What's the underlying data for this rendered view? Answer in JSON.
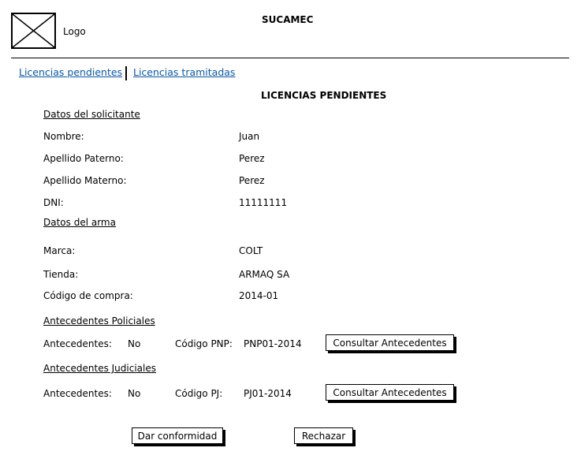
{
  "header": {
    "app_title": "SUCAMEC",
    "logo_label": "Logo"
  },
  "nav": {
    "pending_link": "Licencias pendientes",
    "processed_link": "Licencias tramitadas"
  },
  "page_title": "LICENCIAS PENDIENTES",
  "applicant": {
    "section_title": "Datos del solicitante",
    "fields": [
      {
        "label": "Nombre:",
        "value": "Juan"
      },
      {
        "label": "Apellido Paterno:",
        "value": "Perez"
      },
      {
        "label": "Apellido Materno:",
        "value": "Perez"
      },
      {
        "label": "DNI:",
        "value": "11111111"
      }
    ]
  },
  "weapon": {
    "section_title": "Datos del arma",
    "fields": [
      {
        "label": "Marca:",
        "value": "COLT"
      },
      {
        "label": "Tienda:",
        "value": "ARMAQ SA"
      },
      {
        "label": "Código de compra:",
        "value": "2014-01"
      }
    ]
  },
  "police": {
    "section_title": "Antecedentes Policiales",
    "record_label": "Antecedentes:",
    "record_value": "No",
    "code_label": "Código PNP:",
    "code_value": "PNP01-2014",
    "button": "Consultar Antecedentes"
  },
  "judicial": {
    "section_title": "Antecedentes Judiciales",
    "record_label": "Antecedentes:",
    "record_value": "No",
    "code_label": "Código PJ:",
    "code_value": "PJ01-2014",
    "button": "Consultar Antecedentes"
  },
  "actions": {
    "approve": "Dar conformidad",
    "reject": "Rechazar"
  }
}
